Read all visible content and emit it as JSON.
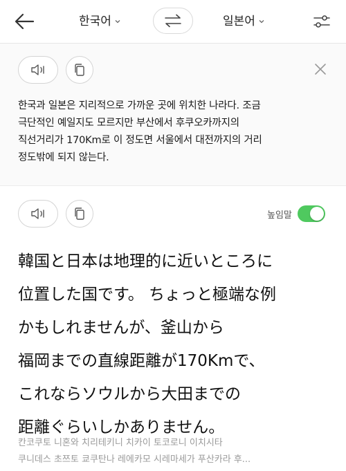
{
  "header": {
    "source_language": "한국어",
    "target_language": "일본어",
    "icons": {
      "back": "back-arrow-icon",
      "swap": "swap-arrows-icon",
      "settings": "sliders-icon",
      "chevron": "chevron-down-icon"
    }
  },
  "source": {
    "text": "한국과 일본은 지리적으로 가까운 곳에 위치한 나라다. 조금\n극단적인 예일지도 모르지만 부산에서 후쿠오카까지의\n직선거리가 170Km로 이 정도면 서울에서 대전까지의 거리\n정도밖에 되지 않는다.",
    "icons": {
      "speak": "speaker-icon",
      "copy": "copy-icon",
      "close": "close-icon"
    }
  },
  "target": {
    "honorific_label": "높임말",
    "honorific_on": true,
    "text": "韓国と日本は地理的に近いところに\n位置した国です。 ちょっと極端な例\nかもしれませんが、釜山から\n福岡までの直線距離が170Kmで、\nこれならソウルから大田までの\n距離ぐらいしかありません。",
    "pronunciation": "칸코쿠토 니혼와 치리테키니 치카이 토코로니 이치시타\n쿠니데스 초쯔토 쿄쿠탄나 레에카모 시레마세가 푸산카라 후...",
    "icons": {
      "speak": "speaker-icon",
      "copy": "copy-icon"
    }
  },
  "colors": {
    "accent_green": "#4fc95f",
    "source_bg": "#fafafa",
    "divider": "#e6e6e6",
    "muted_text": "#9a9a9a"
  }
}
